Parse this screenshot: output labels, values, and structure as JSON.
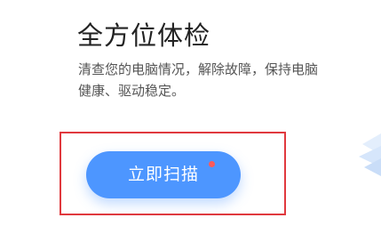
{
  "panel": {
    "title": "全方位体检",
    "description_line1": "清查您的电脑情况，解除故障，保持电脑",
    "description_line2": "健康、驱动稳定。",
    "scan_button_label": "立即扫描"
  },
  "colors": {
    "button": "#4d96ff",
    "highlight_border": "#e0393e",
    "notify_dot": "#ff5a5a"
  },
  "icons": [
    "notification-dot-icon",
    "layered-decoration-icon"
  ]
}
